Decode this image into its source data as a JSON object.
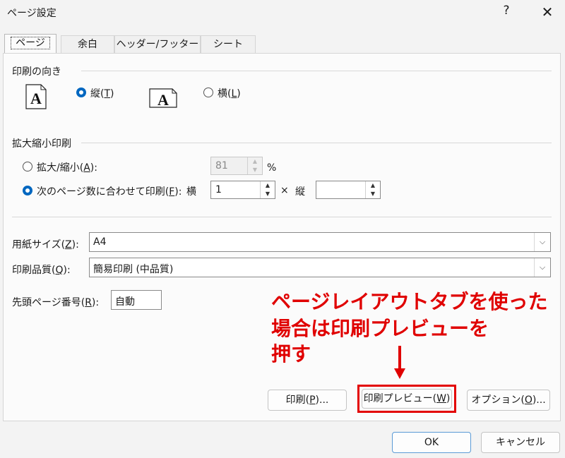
{
  "window": {
    "title": "ページ設定",
    "help": "?",
    "close": "✕"
  },
  "tabs": [
    {
      "label": "ページ"
    },
    {
      "label": "余白"
    },
    {
      "label": "ヘッダー/フッター"
    },
    {
      "label": "シート"
    }
  ],
  "orientation": {
    "heading": "印刷の向き",
    "portrait": {
      "label": "縦(",
      "key": "T",
      "end": ")",
      "selected": true
    },
    "landscape": {
      "label": "横(",
      "key": "L",
      "end": ")",
      "selected": false
    },
    "icon_letter": "A"
  },
  "scaling": {
    "heading": "拡大縮小印刷",
    "zoom": {
      "label": "拡大/縮小(",
      "key": "A",
      "end": "):",
      "value": "81",
      "unit": "%",
      "selected": false
    },
    "fit": {
      "label": "次のページ数に合わせて印刷(",
      "key": "F",
      "end": "):",
      "wide_label": "横",
      "wide_value": "1",
      "x": "×",
      "tall_label": "縦",
      "tall_value": "",
      "selected": true
    }
  },
  "paper_size": {
    "label": "用紙サイズ(",
    "key": "Z",
    "end": "):",
    "value": "A4"
  },
  "print_quality": {
    "label": "印刷品質(",
    "key": "Q",
    "end": "):",
    "value": "簡易印刷 (中品質)"
  },
  "first_page": {
    "label": "先頭ページ番号(",
    "key": "R",
    "end": "):",
    "value": "自動"
  },
  "annotation": {
    "lines": [
      "ページレイアウトタブを使った",
      "場合は印刷プレビューを",
      "押す"
    ],
    "color": "#e00000"
  },
  "buttons": {
    "print": {
      "label": "印刷(",
      "key": "P",
      "end": ")..."
    },
    "preview": {
      "label": "印刷プレビュー(",
      "key": "W",
      "end": ")"
    },
    "options": {
      "label": "オプション(",
      "key": "O",
      "end": ")..."
    },
    "ok": "OK",
    "cancel": "キャンセル"
  },
  "icons": {
    "up": "▲",
    "down": "▼",
    "chevron": "⌵"
  },
  "colors": {
    "accent": "#0067c0",
    "highlight": "#e30000"
  }
}
